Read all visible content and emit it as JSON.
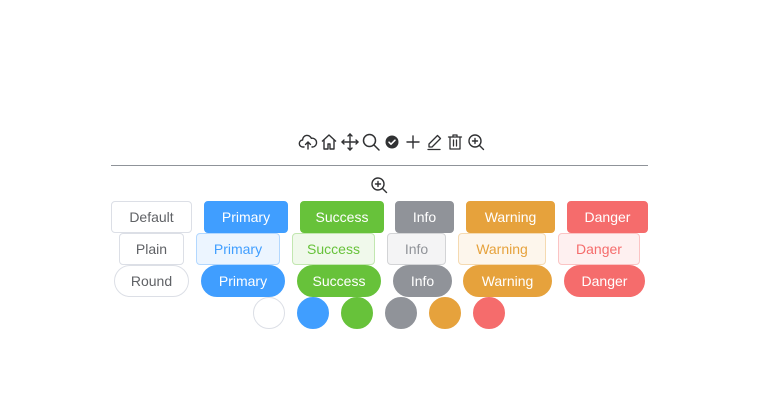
{
  "icons": [
    "upload-cloud-icon",
    "home-icon",
    "move-arrows-icon",
    "search-icon",
    "circle-check-icon",
    "plus-icon",
    "edit-icon",
    "delete-icon",
    "zoom-in-icon"
  ],
  "single_icon": "zoom-in-icon",
  "buttons": {
    "default_row": [
      "Default",
      "Primary",
      "Success",
      "Info",
      "Warning",
      "Danger"
    ],
    "plain_row": [
      "Plain",
      "Primary",
      "Success",
      "Info",
      "Warning",
      "Danger"
    ],
    "round_row": [
      "Round",
      "Primary",
      "Success",
      "Info",
      "Warning",
      "Danger"
    ]
  },
  "colors": {
    "primary": "#409eff",
    "success": "#67c23a",
    "info": "#909399",
    "warning": "#e6a23c",
    "danger": "#f56c6c",
    "default_border": "#dcdfe6",
    "text": "#606266"
  }
}
